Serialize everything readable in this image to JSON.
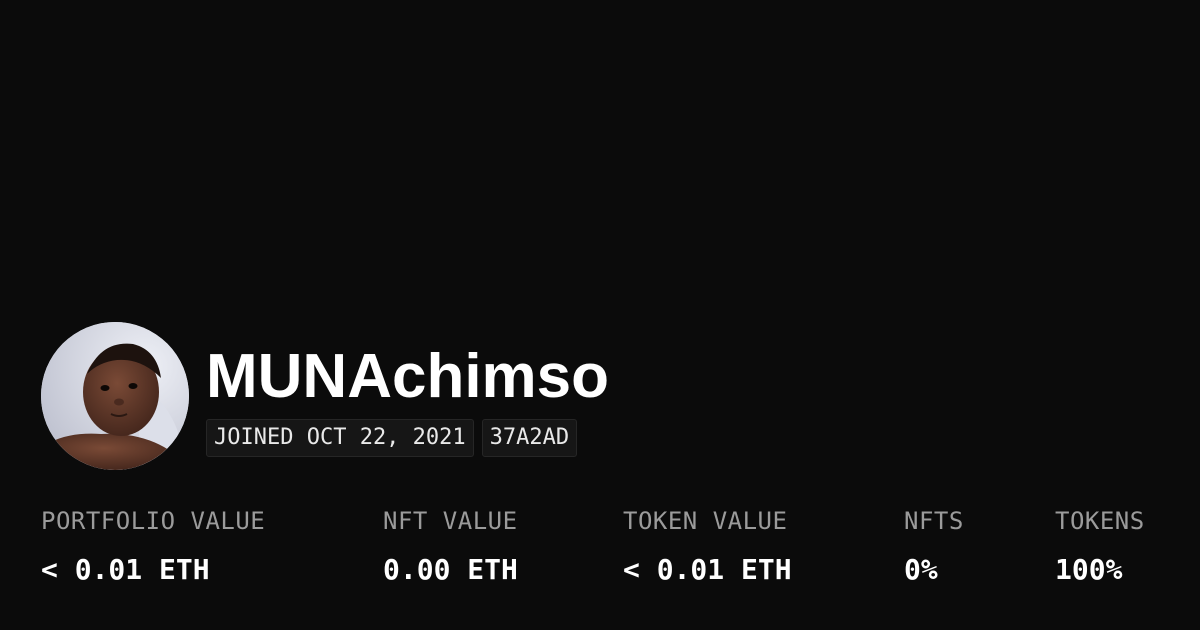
{
  "profile": {
    "username": "MUNAchimso",
    "joined": "JOINED OCT 22, 2021",
    "address_short": "37A2AD",
    "avatar_icon": "profile-photo"
  },
  "stats": [
    {
      "label": "PORTFOLIO VALUE",
      "value": "< 0.01 ETH"
    },
    {
      "label": "NFT VALUE",
      "value": "0.00 ETH"
    },
    {
      "label": "TOKEN VALUE",
      "value": "< 0.01 ETH"
    },
    {
      "label": "NFTS",
      "value": "0%"
    },
    {
      "label": "TOKENS",
      "value": "100%"
    }
  ],
  "colors": {
    "background": "#0b0b0b",
    "text": "#ffffff",
    "muted": "#9b9b9b",
    "badge_bg": "#161616"
  }
}
